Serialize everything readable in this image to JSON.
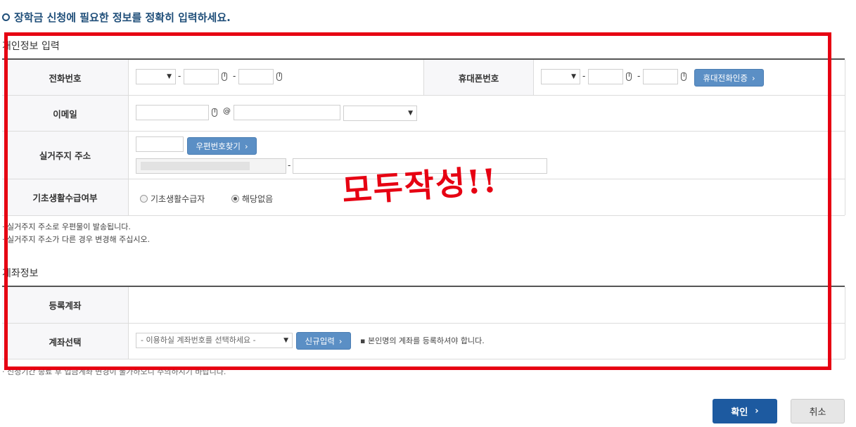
{
  "heading": "장학금 신청에 필요한 정보를 정확히 입력하세요.",
  "personal": {
    "section_title": "개인정보 입력",
    "phone_label": "전화번호",
    "mobile_label": "휴대폰번호",
    "mobile_verify_button": "휴대전화인증",
    "email_label": "이메일",
    "email_at": "@",
    "address_label": "실거주지 주소",
    "zip_button": "우편번호찾기",
    "basic_label": "기초생활수급여부",
    "basic_option_yes": "기초생활수급자",
    "basic_option_no": "해당없음",
    "basic_selected": "해당없음",
    "notes": [
      "실거주지 주소로 우편물이 발송됩니다.",
      "실거주지 주소가 다른 경우 변경해 주십시오."
    ]
  },
  "account": {
    "section_title": "계좌정보",
    "registered_label": "등록계좌",
    "select_label": "계좌선택",
    "select_placeholder": "- 이용하실 계좌번호를 선택하세요 -",
    "new_button": "신규입력",
    "note": "본인명의 계좌를 등록하셔야 합니다.",
    "footer_note": "신청기간 종료 후 입금계좌 변경이 불가하오니 주의하시기 바랍니다."
  },
  "annotation": "모두작성!!",
  "actions": {
    "confirm": "확인",
    "cancel": "취소"
  },
  "colors": {
    "accent": "#1d5aa0",
    "button": "#5b8fc5",
    "annotation": "#e60012"
  }
}
